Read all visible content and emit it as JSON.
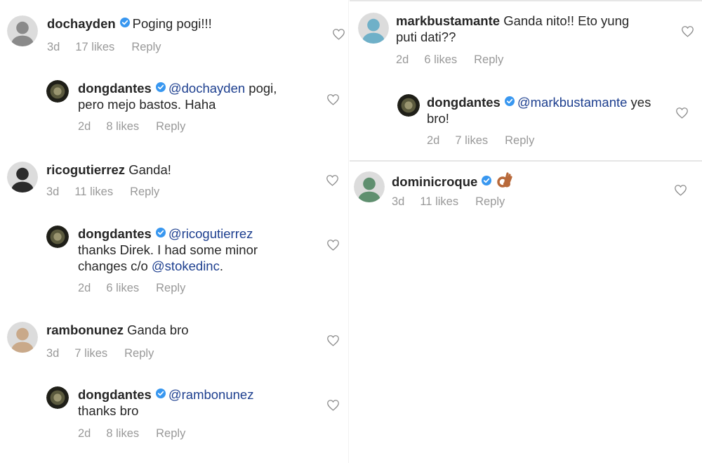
{
  "left_comments": [
    {
      "username": "dochayden",
      "verified": true,
      "text_parts": [
        {
          "t": "Poging pogi!!!",
          "mention": false
        }
      ],
      "time": "3d",
      "likes": "17 likes",
      "reply": "Reply",
      "avatar_color": "#8a8a8a"
    },
    {
      "username": "dongdantes",
      "verified": true,
      "text_parts": [
        {
          "t": "@dochayden",
          "mention": true
        },
        {
          "t": " pogi, pero mejo bastos. Haha",
          "mention": false
        }
      ],
      "time": "2d",
      "likes": "8 likes",
      "reply": "Reply",
      "avatar_color": "#3a3a2a"
    },
    {
      "username": "ricogutierrez",
      "verified": false,
      "text_parts": [
        {
          "t": "Ganda!",
          "mention": false
        }
      ],
      "time": "3d",
      "likes": "11 likes",
      "reply": "Reply",
      "avatar_color": "#2b2b2b"
    },
    {
      "username": "dongdantes",
      "verified": true,
      "text_parts": [
        {
          "t": "@ricogutierrez",
          "mention": true
        },
        {
          "t": " thanks Direk. I had some minor changes c/o ",
          "mention": false
        },
        {
          "t": "@stokedinc",
          "mention": true
        },
        {
          "t": ".",
          "mention": false
        }
      ],
      "time": "2d",
      "likes": "6 likes",
      "reply": "Reply",
      "avatar_color": "#3a3a2a"
    },
    {
      "username": "rambonunez",
      "verified": false,
      "text_parts": [
        {
          "t": "Ganda bro",
          "mention": false
        }
      ],
      "time": "3d",
      "likes": "7 likes",
      "reply": "Reply",
      "avatar_color": "#c9a98a"
    },
    {
      "username": "dongdantes",
      "verified": true,
      "text_parts": [
        {
          "t": "@rambonunez",
          "mention": true
        },
        {
          "t": " thanks bro",
          "mention": false
        }
      ],
      "time": "2d",
      "likes": "8 likes",
      "reply": "Reply",
      "avatar_color": "#3a3a2a"
    }
  ],
  "right_comments": [
    {
      "username": "markbustamante",
      "verified": false,
      "text_parts": [
        {
          "t": "Ganda nito!! Eto yung puti dati??",
          "mention": false
        }
      ],
      "time": "2d",
      "likes": "6 likes",
      "reply": "Reply",
      "avatar_color": "#6fb0c8"
    },
    {
      "username": "dongdantes",
      "verified": true,
      "text_parts": [
        {
          "t": "@markbustamante",
          "mention": true
        },
        {
          "t": " yes bro!",
          "mention": false
        }
      ],
      "time": "2d",
      "likes": "7 likes",
      "reply": "Reply",
      "avatar_color": "#3a3a2a"
    },
    {
      "username": "dominicroque",
      "verified": true,
      "text_parts": [],
      "emoji": "ok-hand-emoji",
      "time": "3d",
      "likes": "11 likes",
      "reply": "Reply",
      "avatar_color": "#5f8f6f"
    }
  ],
  "colors": {
    "verified_badge": "#3897f0",
    "mention": "#1d3f8f",
    "meta_text": "#999999",
    "heart_outline": "#8e8e8e"
  },
  "icons": {
    "like": "heart-outline-icon",
    "verified": "verified-badge-icon"
  }
}
